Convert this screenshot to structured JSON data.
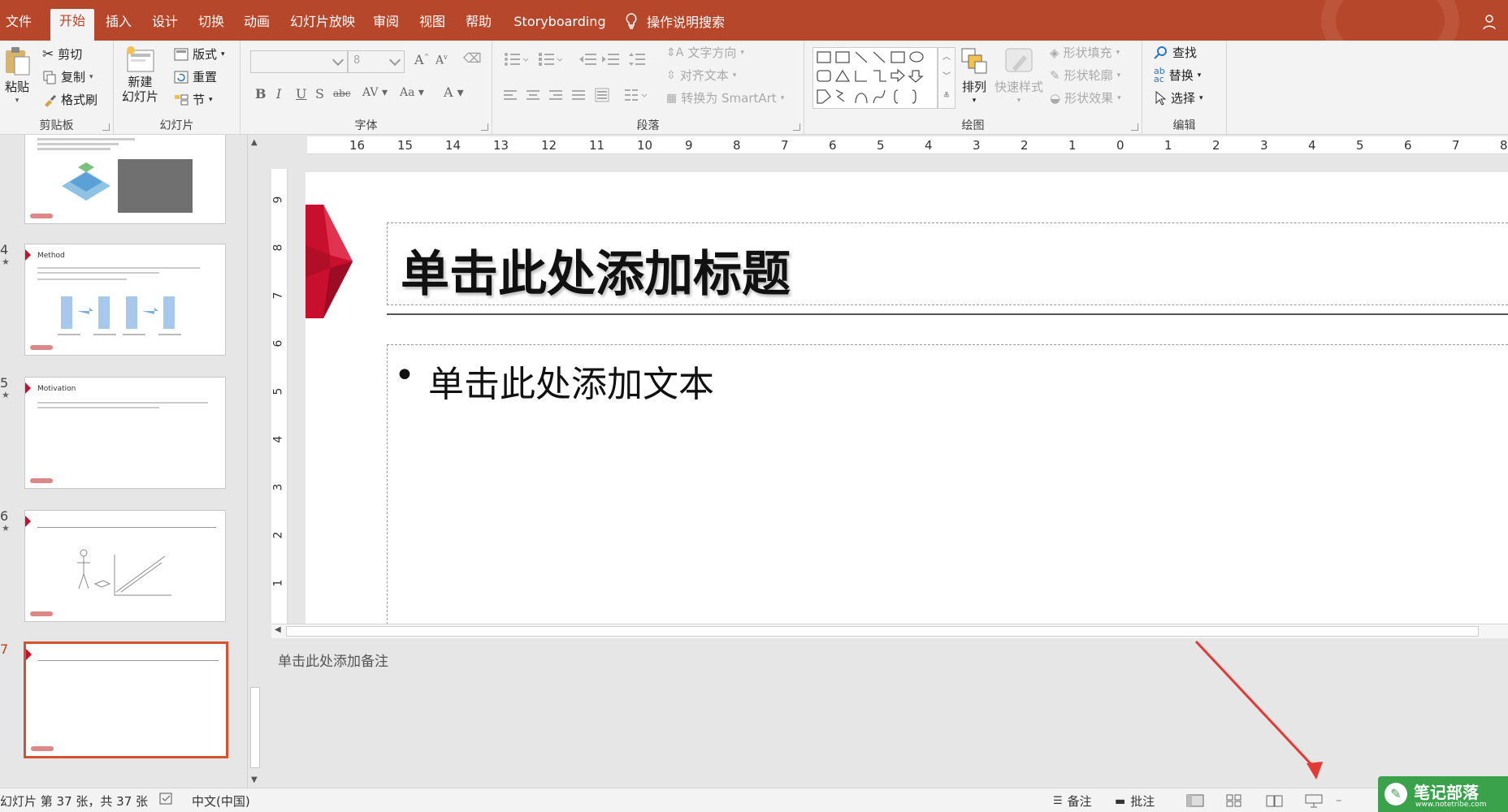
{
  "tabs": [
    {
      "label": "文件"
    },
    {
      "label": "开始"
    },
    {
      "label": "插入"
    },
    {
      "label": "设计"
    },
    {
      "label": "切换"
    },
    {
      "label": "动画"
    },
    {
      "label": "幻灯片放映"
    },
    {
      "label": "审阅"
    },
    {
      "label": "视图"
    },
    {
      "label": "帮助"
    },
    {
      "label": "Storyboarding"
    }
  ],
  "tell_me": "操作说明搜索",
  "ribbon": {
    "clipboard": {
      "paste": "粘贴",
      "cut": "剪切",
      "copy": "复制",
      "format_painter": "格式刷",
      "label": "剪贴板"
    },
    "slides": {
      "new_slide_1": "新建",
      "new_slide_2": "幻灯片",
      "layout": "版式",
      "reset": "重置",
      "section": "节",
      "label": "幻灯片"
    },
    "font": {
      "font_size": "8",
      "label": "字体"
    },
    "paragraph": {
      "text_direction": "文字方向",
      "align_text": "对齐文本",
      "smartart": "转换为 SmartArt",
      "label": "段落"
    },
    "drawing": {
      "arrange": "排列",
      "quick_styles": "快速样式",
      "shape_fill": "形状填充",
      "shape_outline": "形状轮廓",
      "shape_effects": "形状效果",
      "label": "绘图"
    },
    "editing": {
      "find": "查找",
      "replace": "替换",
      "select": "选择",
      "label": "编辑"
    }
  },
  "thumbnails": [
    {
      "number": "",
      "title": ""
    },
    {
      "number": "4",
      "title": "Method"
    },
    {
      "number": "5",
      "title": "Motivation"
    },
    {
      "number": "6",
      "title": ""
    },
    {
      "number": "7",
      "title": ""
    }
  ],
  "ruler_h": [
    "16",
    "15",
    "14",
    "13",
    "12",
    "11",
    "10",
    "9",
    "8",
    "7",
    "6",
    "5",
    "4",
    "3",
    "2",
    "1",
    "0",
    "1",
    "2",
    "3",
    "4",
    "5",
    "6",
    "7",
    "8"
  ],
  "ruler_v": [
    "9",
    "8",
    "7",
    "6",
    "5",
    "4",
    "3",
    "2",
    "1"
  ],
  "slide": {
    "title_placeholder": "单击此处添加标题",
    "body_placeholder": "单击此处添加文本",
    "bullet": "•"
  },
  "notes_placeholder": "单击此处添加备注",
  "status": {
    "slide_info": "幻灯片 第 37 张，共 37 张",
    "language": "中文(中国)",
    "notes": "备注",
    "comments": "批注"
  },
  "watermark": {
    "text": "笔记部落",
    "url": "www.notetribe.com"
  },
  "colors": {
    "accent": "#b7472a",
    "selected_border": "#d35230",
    "slide_logo": "#c8102e"
  }
}
